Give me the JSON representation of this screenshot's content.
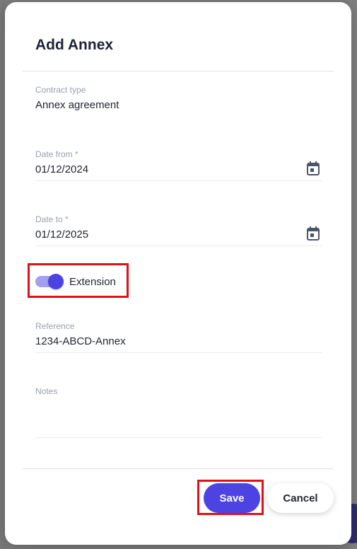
{
  "dialog": {
    "title": "Add Annex",
    "fields": {
      "contract_type": {
        "label": "Contract type",
        "value": "Annex agreement"
      },
      "date_from": {
        "label": "Date from *",
        "value": "01/12/2024",
        "icon": "calendar-icon"
      },
      "date_to": {
        "label": "Date to *",
        "value": "01/12/2025",
        "icon": "calendar-icon"
      },
      "reference": {
        "label": "Reference",
        "value": "1234-ABCD-Annex"
      },
      "notes": {
        "label": "Notes",
        "value": ""
      }
    },
    "extension": {
      "label": "Extension",
      "checked": true
    },
    "buttons": {
      "save": "Save",
      "cancel": "Cancel"
    }
  },
  "colors": {
    "accent": "#4d43e2",
    "accent_light": "#a3a0ef",
    "highlight": "#e0101b",
    "text": "#23262f",
    "label": "#9aa0ab"
  }
}
